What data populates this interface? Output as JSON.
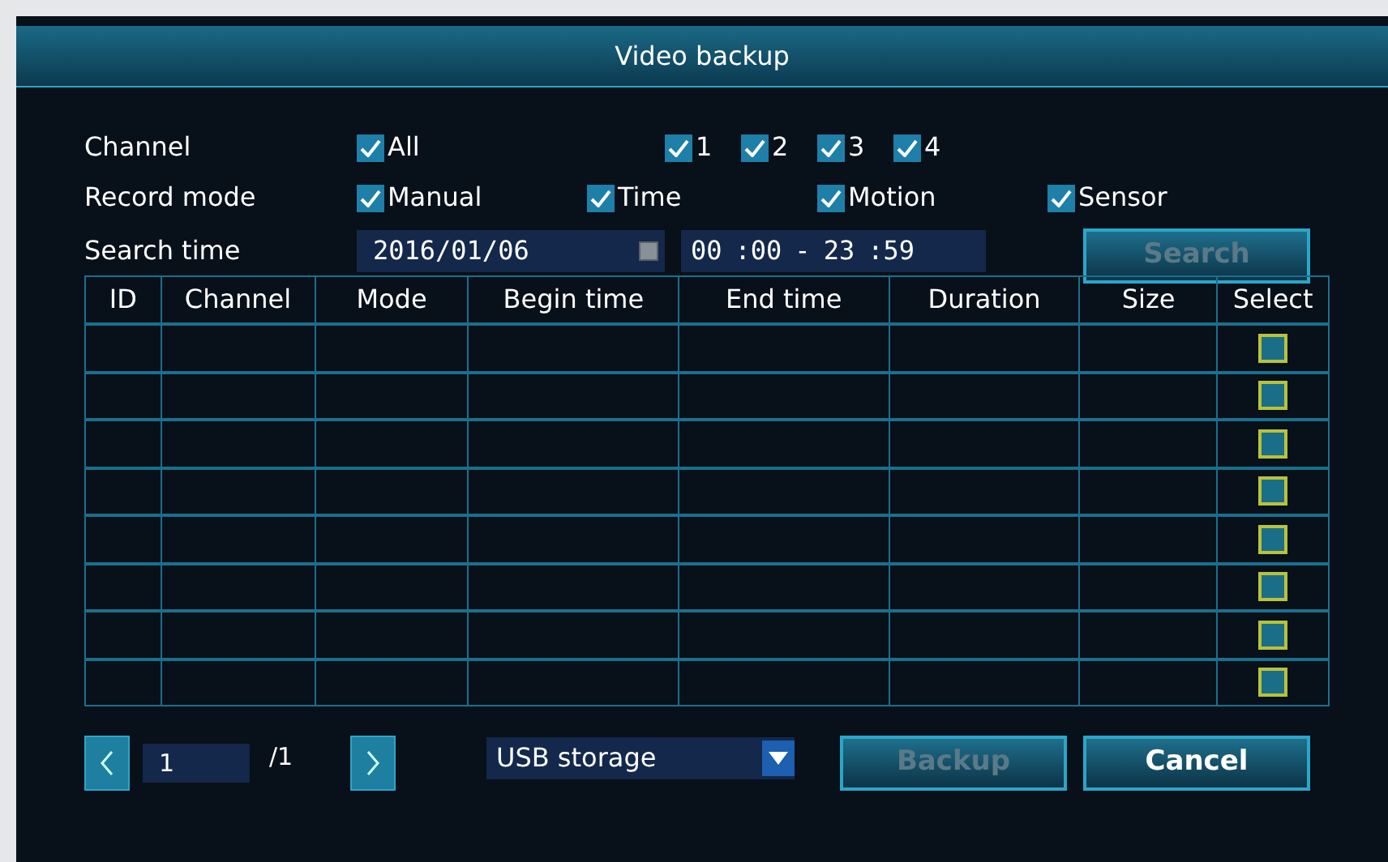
{
  "window": {
    "title": "Video backup"
  },
  "channel": {
    "label": "Channel",
    "all": {
      "label": "All",
      "checked": true
    },
    "items": [
      {
        "label": "1",
        "checked": true
      },
      {
        "label": "2",
        "checked": true
      },
      {
        "label": "3",
        "checked": true
      },
      {
        "label": "4",
        "checked": true
      }
    ]
  },
  "record_mode": {
    "label": "Record mode",
    "items": [
      {
        "label": "Manual",
        "checked": true
      },
      {
        "label": "Time",
        "checked": true
      },
      {
        "label": "Motion",
        "checked": true
      },
      {
        "label": "Sensor",
        "checked": true
      }
    ]
  },
  "search_time": {
    "label": "Search time",
    "date": "2016/01/06",
    "start_hour": "00",
    "start_minute": ":00",
    "separator": "-",
    "end_hour": "23",
    "end_minute": ":59"
  },
  "search_button": {
    "label": "Search",
    "disabled": true
  },
  "table": {
    "columns": [
      "ID",
      "Channel",
      "Mode",
      "Begin time",
      "End time",
      "Duration",
      "Size",
      "Select"
    ],
    "rows": [
      {
        "checked": false
      },
      {
        "checked": false
      },
      {
        "checked": false
      },
      {
        "checked": false
      },
      {
        "checked": false
      },
      {
        "checked": false
      },
      {
        "checked": false
      },
      {
        "checked": false
      }
    ]
  },
  "pager": {
    "page": "1",
    "total": "/1"
  },
  "storage": {
    "value": "USB storage"
  },
  "buttons": [
    {
      "label": "Backup",
      "disabled": true
    },
    {
      "label": "Cancel",
      "disabled": false
    }
  ]
}
